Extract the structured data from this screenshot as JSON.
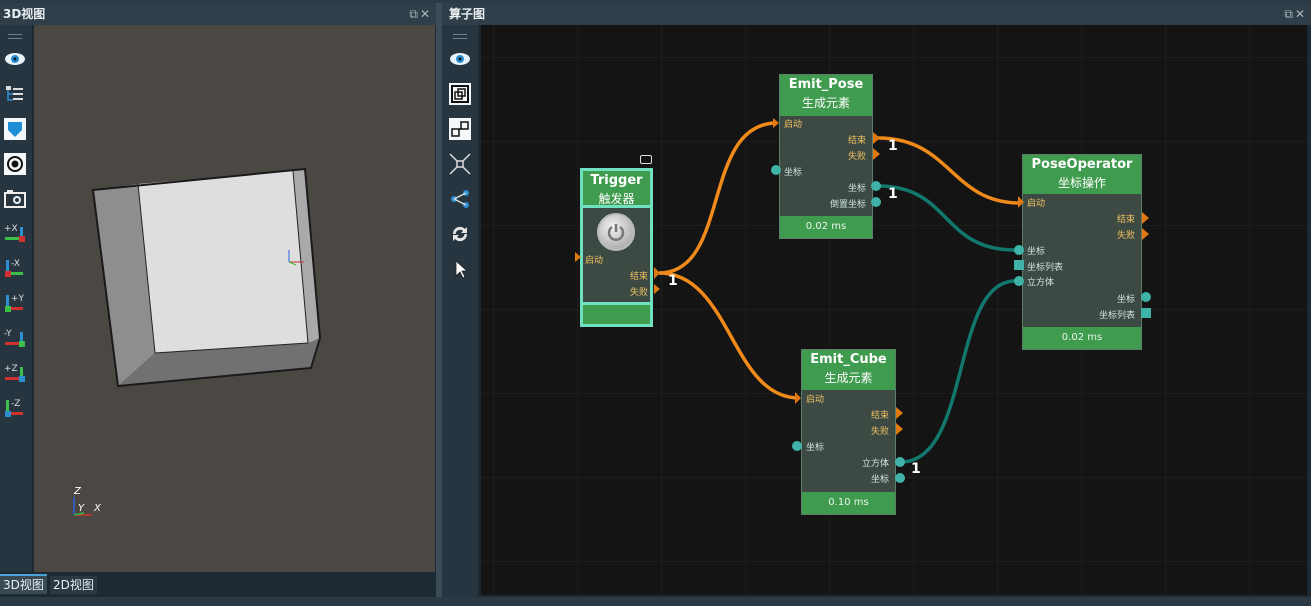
{
  "left_panel": {
    "title": "3D视图",
    "window_buttons": "⧉✕",
    "tools": [
      "eye-icon",
      "tree-icon",
      "shield-icon",
      "target-icon",
      "camera-icon",
      "view-plus-x-icon",
      "view-minus-x-icon",
      "view-plus-y-icon",
      "view-minus-y-icon",
      "view-plus-z-icon",
      "view-minus-z-icon"
    ],
    "axis_labels": {
      "z": "Z",
      "y": "Y",
      "x": "X"
    },
    "tabs": [
      "3D视图",
      "2D视图"
    ]
  },
  "right_panel": {
    "title": "算子图",
    "window_buttons": "⧉✕",
    "tools": [
      "eye-icon",
      "frame-icon",
      "connect-icon",
      "collapse-icon",
      "share-icon",
      "refresh-icon",
      "pointer-icon"
    ]
  },
  "nodes": {
    "trigger": {
      "name": "Trigger",
      "subtitle": "触发器",
      "in_start": "启动",
      "out_end": "结束",
      "out_fail": "失败"
    },
    "emit_pose": {
      "name": "Emit_Pose",
      "subtitle": "生成元素",
      "in_start": "启动",
      "in_coord": "坐标",
      "out_end": "结束",
      "out_fail": "失败",
      "out_coord": "坐标",
      "out_inv": "倒置坐标",
      "time": "0.02 ms"
    },
    "emit_cube": {
      "name": "Emit_Cube",
      "subtitle": "生成元素",
      "in_start": "启动",
      "in_coord": "坐标",
      "out_end": "结束",
      "out_fail": "失败",
      "out_cube": "立方体",
      "out_coord": "坐标",
      "time": "0.10 ms"
    },
    "pose_op": {
      "name": "PoseOperator",
      "subtitle": "坐标操作",
      "in_start": "启动",
      "in_coord": "坐标",
      "in_coord_list": "坐标列表",
      "in_cube": "立方体",
      "out_end": "结束",
      "out_fail": "失败",
      "out_coord": "坐标",
      "out_coord_list": "坐标列表",
      "time": "0.02 ms"
    }
  },
  "edge_labels": [
    "1",
    "1",
    "1",
    "1"
  ],
  "colors": {
    "exec_edge": "#f08a1a",
    "data_edge": "#1a7a70",
    "node_head": "#3f9b4e",
    "trigger_border": "#6fe0c0"
  }
}
